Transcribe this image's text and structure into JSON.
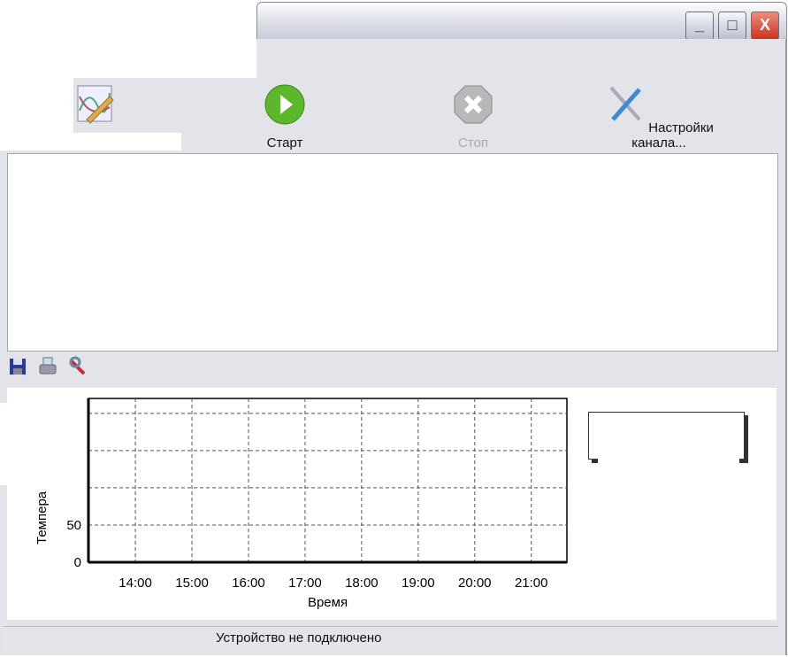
{
  "window": {
    "buttons": {
      "minimize": "_",
      "maximize": "□",
      "close": "X"
    }
  },
  "toolbar": {
    "items": [
      {
        "label": "Старт",
        "icon": "play-icon",
        "enabled": true
      },
      {
        "label": "Стоп",
        "icon": "stop-icon",
        "enabled": false
      },
      {
        "label": "Настройки канала...",
        "icon": "tools-icon",
        "enabled": true
      }
    ]
  },
  "chart_toolbar": {
    "icons": [
      "save-icon",
      "print-icon",
      "settings-icon"
    ]
  },
  "chart_data": {
    "type": "line",
    "xlabel": "Время",
    "ylabel": "Темпера",
    "x_ticks": [
      "14:00",
      "15:00",
      "16:00",
      "17:00",
      "18:00",
      "19:00",
      "20:00",
      "21:00"
    ],
    "y_ticks": [
      0,
      50
    ],
    "y_grid": [
      0,
      50,
      100,
      150,
      200
    ],
    "ylim": [
      0,
      220
    ],
    "xlim_hours": [
      13.17,
      21.63
    ],
    "grid": true,
    "series": [],
    "legend": "top-right"
  },
  "status": {
    "text": "Устройство не подключено"
  }
}
